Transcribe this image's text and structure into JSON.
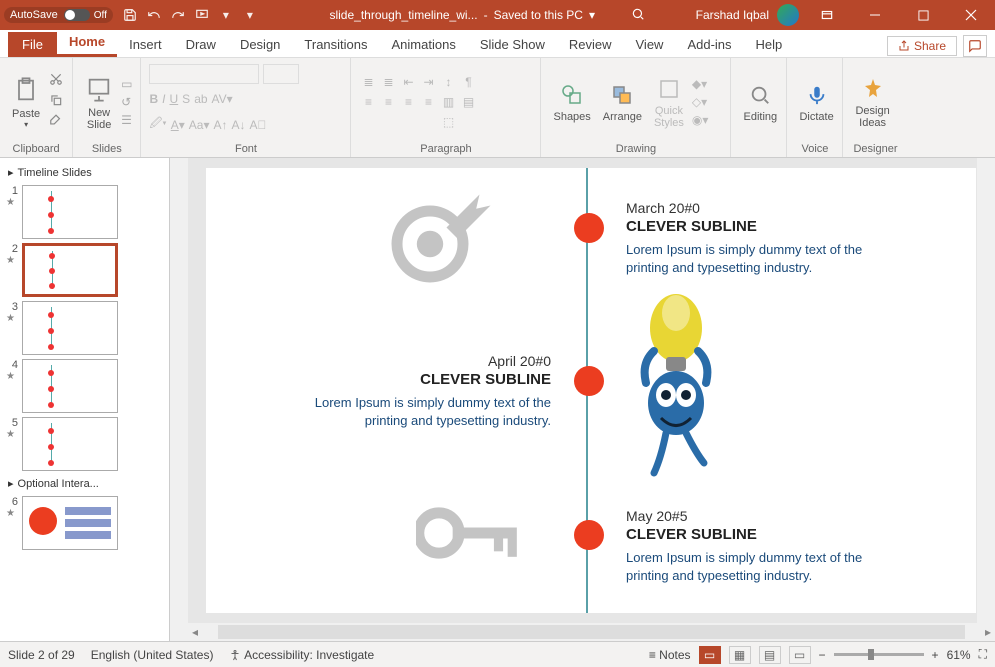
{
  "titlebar": {
    "autosave_label": "AutoSave",
    "autosave_state": "Off",
    "filename": "slide_through_timeline_wi...",
    "saved_status": "Saved to this PC",
    "user_name": "Farshad Iqbal"
  },
  "tabs": {
    "file": "File",
    "list": [
      "Home",
      "Insert",
      "Draw",
      "Design",
      "Transitions",
      "Animations",
      "Slide Show",
      "Review",
      "View",
      "Add-ins",
      "Help"
    ],
    "active": "Home",
    "share": "Share"
  },
  "ribbon": {
    "clipboard": {
      "paste": "Paste",
      "label": "Clipboard"
    },
    "slides": {
      "new_slide": "New\nSlide",
      "label": "Slides"
    },
    "font": {
      "label": "Font"
    },
    "paragraph": {
      "label": "Paragraph"
    },
    "drawing": {
      "shapes": "Shapes",
      "arrange": "Arrange",
      "quick_styles": "Quick\nStyles",
      "label": "Drawing"
    },
    "editing": {
      "editing": "Editing",
      "label": ""
    },
    "voice": {
      "dictate": "Dictate",
      "label": "Voice"
    },
    "designer": {
      "design_ideas": "Design\nIdeas",
      "label": "Designer"
    }
  },
  "thumbs": {
    "section1": "Timeline Slides",
    "section2": "Optional Intera...",
    "items": [
      {
        "n": "1"
      },
      {
        "n": "2"
      },
      {
        "n": "3"
      },
      {
        "n": "4"
      },
      {
        "n": "5"
      },
      {
        "n": "6"
      }
    ]
  },
  "slide": {
    "item1": {
      "date": "March 20#0",
      "sub": "CLEVER SUBLINE",
      "body": "Lorem Ipsum is simply dummy text of the printing and typesetting industry."
    },
    "item2": {
      "date": "April 20#0",
      "sub": "CLEVER SUBLINE",
      "body": "Lorem Ipsum is simply dummy text of the printing and typesetting industry."
    },
    "item3": {
      "date": "May 20#5",
      "sub": "CLEVER SUBLINE",
      "body": "Lorem Ipsum is simply dummy text of the printing and typesetting industry."
    }
  },
  "status": {
    "slide_counter": "Slide 2 of 29",
    "language": "English (United States)",
    "accessibility": "Accessibility: Investigate",
    "notes": "Notes",
    "zoom": "61%"
  }
}
